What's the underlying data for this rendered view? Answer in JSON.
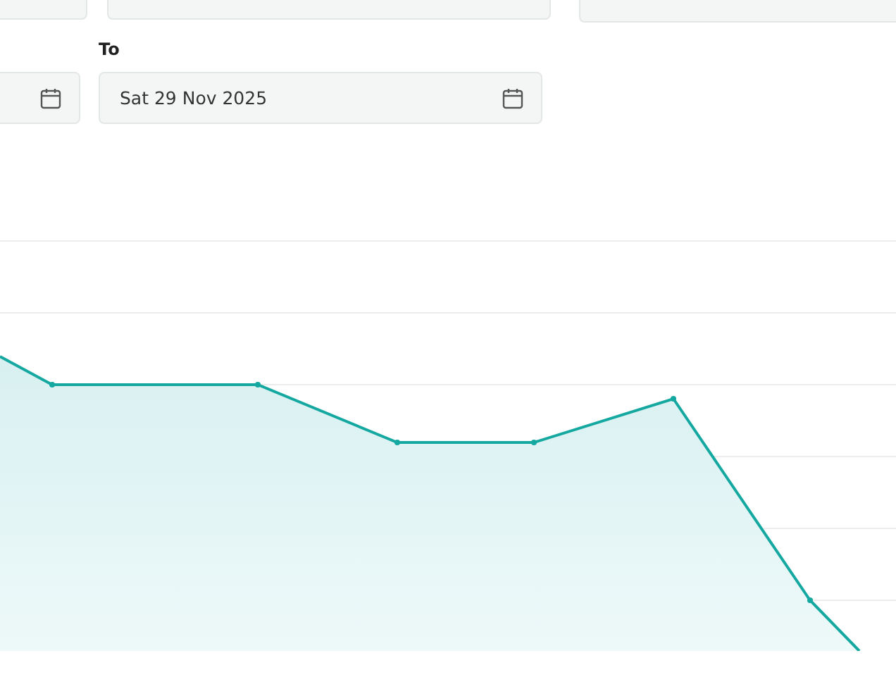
{
  "date_range": {
    "to_label": "To",
    "to_value": "Sat 29 Nov 2025"
  }
}
